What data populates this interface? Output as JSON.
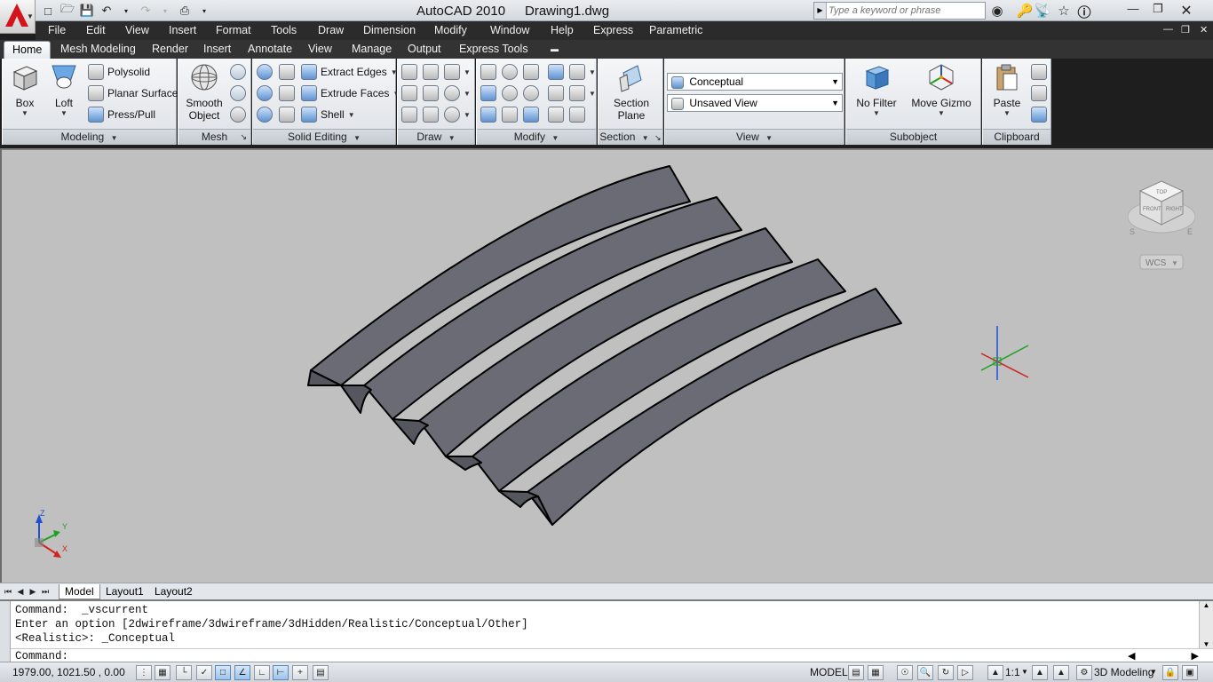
{
  "title_bar": {
    "app_title": "AutoCAD 2010",
    "doc_title": "Drawing1.dwg",
    "search_placeholder": "Type a keyword or phrase"
  },
  "menu": [
    "File",
    "Edit",
    "View",
    "Insert",
    "Format",
    "Tools",
    "Draw",
    "Dimension",
    "Modify",
    "Window",
    "Help",
    "Express",
    "Parametric"
  ],
  "ribbon_tabs": [
    "Home",
    "Mesh Modeling",
    "Render",
    "Insert",
    "Annotate",
    "View",
    "Manage",
    "Output",
    "Express Tools"
  ],
  "active_tab": "Home",
  "panels": {
    "modeling": {
      "title": "Modeling",
      "box": "Box",
      "loft": "Loft",
      "polysolid": "Polysolid",
      "planar_surface": "Planar Surface",
      "press_pull": "Press/Pull"
    },
    "mesh": {
      "title": "Mesh",
      "smooth_object_line1": "Smooth",
      "smooth_object_line2": "Object"
    },
    "solid_editing": {
      "title": "Solid Editing",
      "extract_edges": "Extract Edges",
      "extrude_faces": "Extrude Faces",
      "shell": "Shell"
    },
    "draw": {
      "title": "Draw"
    },
    "modify": {
      "title": "Modify"
    },
    "section": {
      "title": "Section",
      "section_plane_line1": "Section",
      "section_plane_line2": "Plane"
    },
    "view": {
      "title": "View",
      "visual_style": "Conceptual",
      "named_view": "Unsaved View"
    },
    "subobject": {
      "title": "Subobject",
      "no_filter": "No Filter",
      "move_gizmo": "Move Gizmo"
    },
    "clipboard": {
      "title": "Clipboard",
      "paste": "Paste"
    }
  },
  "viewcube": {
    "top": "TOP",
    "front": "FRONT",
    "right": "RIGHT",
    "south": "S",
    "east": "E",
    "wcs_label": "WCS"
  },
  "ucs_icon": {
    "x": "X",
    "y": "Y",
    "z": "Z"
  },
  "layout_tabs": [
    "Model",
    "Layout1",
    "Layout2"
  ],
  "command_history": [
    "Command:  _vscurrent",
    "Enter an option [2dwireframe/3dwireframe/3dHidden/Realistic/Conceptual/Other]",
    "<Realistic>: _Conceptual"
  ],
  "command_prompt": "Command:",
  "status_bar": {
    "coordinates": "1979.00, 1021.50 , 0.00",
    "model_label": "MODEL",
    "annotation_scale": "1:1",
    "workspace": "3D Modeling"
  },
  "colors": {
    "viewport_bg": "#c0c0c0",
    "solid_top": "#6a6b74",
    "solid_side": "#55565e",
    "menu_bg": "#2b2b2b",
    "axis_x": "#d42020",
    "axis_y": "#20a020",
    "axis_z": "#2050d0"
  }
}
